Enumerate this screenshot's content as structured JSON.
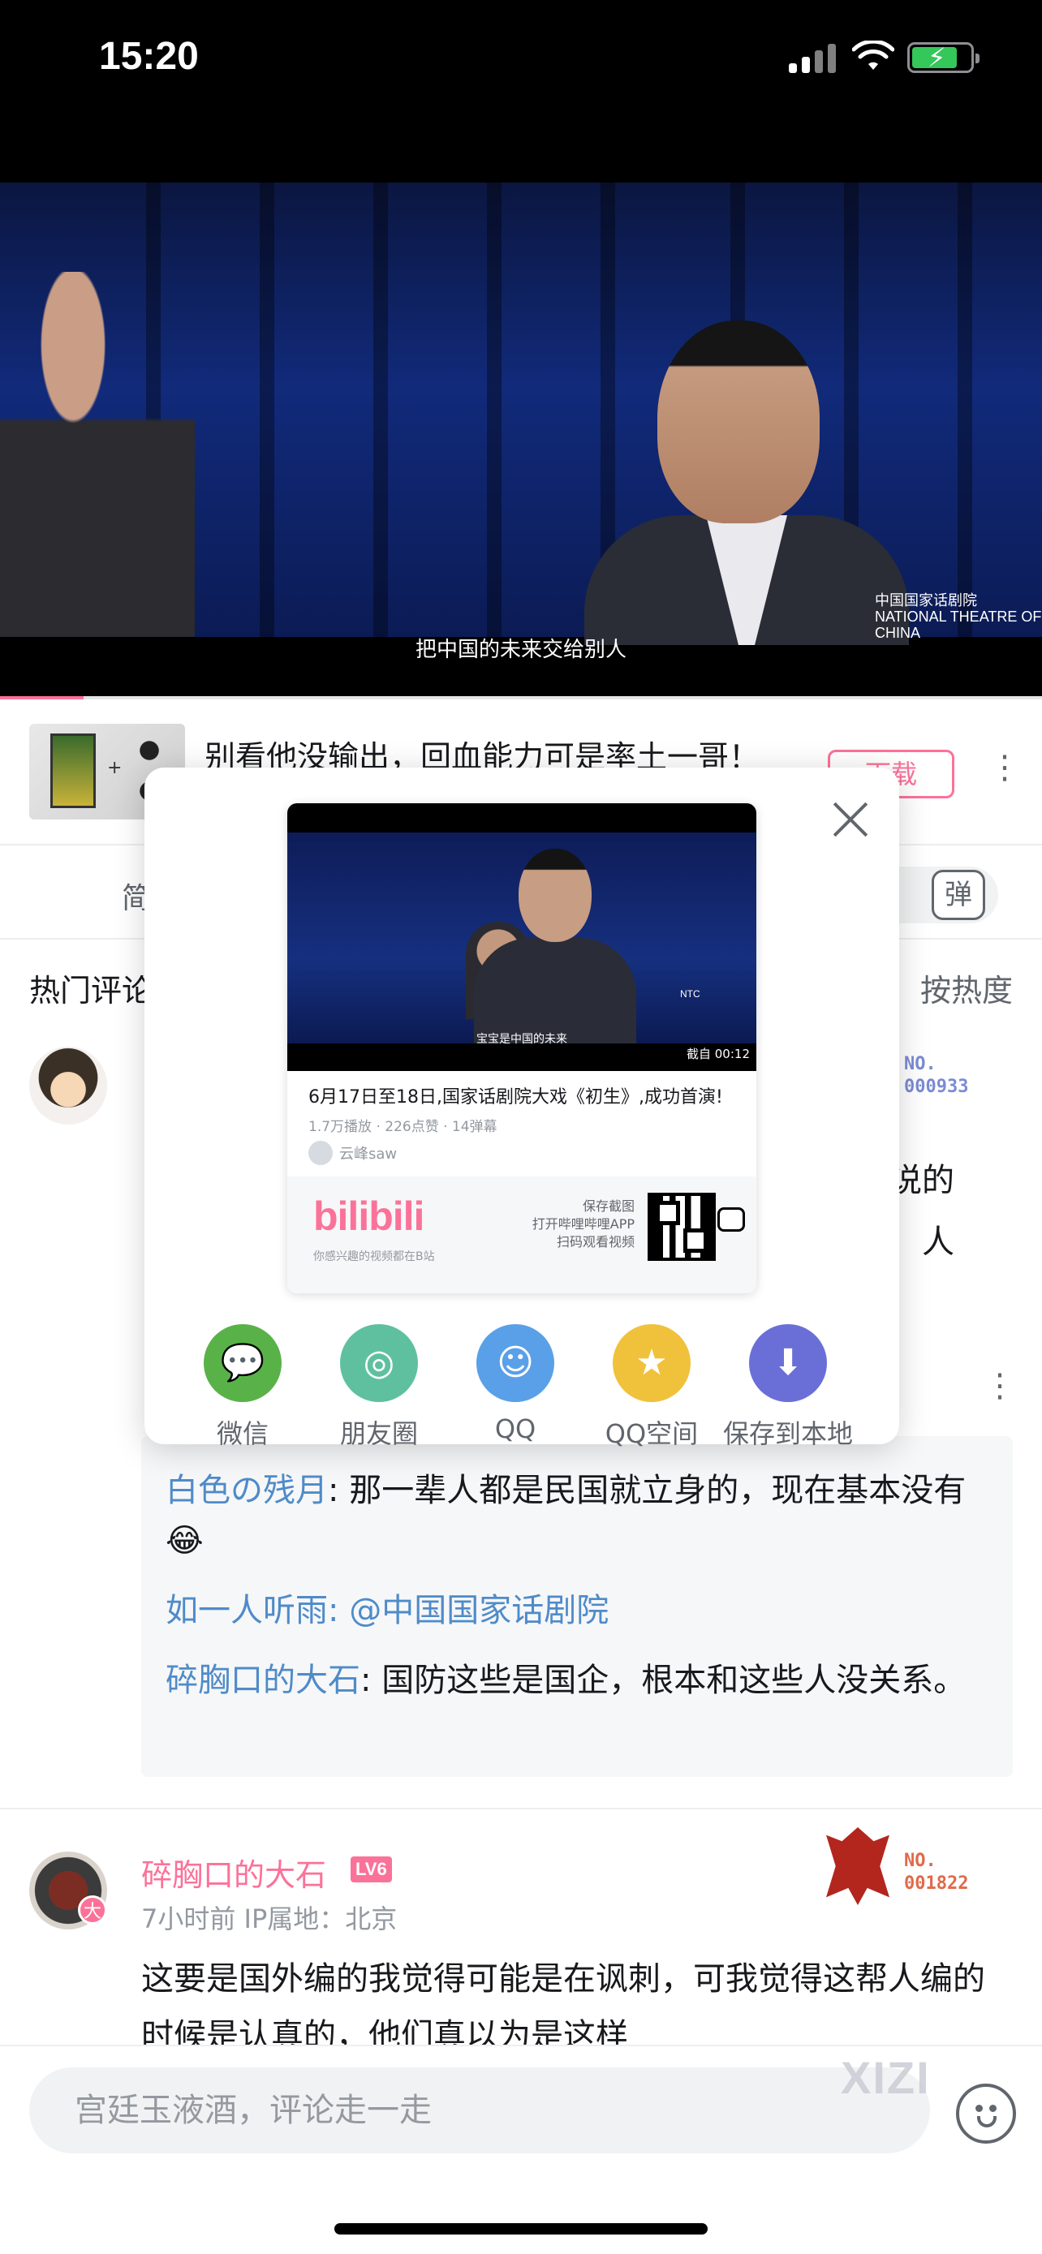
{
  "status_bar": {
    "time": "15:20"
  },
  "video": {
    "subtitle": "把中国的未来交给别人",
    "channel_logo": "中国国家话剧院\nNATIONAL THEATRE OF CHINA",
    "progress_fraction": 0.08
  },
  "related": {
    "title": "别看他没输出，回血能力可是率土一哥！",
    "download_label": "下载"
  },
  "tabs": {
    "intro": "简"
  },
  "comments": {
    "header": "热门评论",
    "sort": "按热度",
    "first": {
      "badge_no": "NO.",
      "badge_num": "000933",
      "partial_right_1": "说的",
      "partial_right_2": "人"
    },
    "replies": [
      {
        "name": "白色の残月",
        "text": ": 那一辈人都是民国就立身的，现在基本没有"
      },
      {
        "name": "如一人听雨",
        "text": ": @中国国家话剧院"
      },
      {
        "name": "碎胸口的大石",
        "text": ": 国防这些是国企，根本和这些人没关系。"
      }
    ],
    "second": {
      "user": "碎胸口的大石",
      "level": "LV6",
      "meta": "7小时前  IP属地：北京",
      "badge_no": "NO.",
      "badge_num": "001822",
      "vip": "大",
      "text": "这要是国外编的我觉得可能是在讽刺，可我觉得这帮人编的时候是认真的，他们真以为是这样"
    }
  },
  "bottom": {
    "input_placeholder": "宫廷玉液酒，评论走一走",
    "watermark": "XIZI"
  },
  "share": {
    "card": {
      "subtitle": "宝宝是中国的未来",
      "time": "截自 00:12",
      "title": "6月17日至18日,国家话剧院大戏《初生》,成功首演!",
      "stats": "1.7万播放 · 226点赞 · 14弹幕",
      "author": "云峰saw",
      "bili_logo": "bilibili",
      "tagline": "你感兴趣的视频都在B站",
      "qr_hint": [
        "保存截图",
        "打开哔哩哔哩APP",
        "扫码观看视频"
      ]
    },
    "targets": [
      {
        "label": "微信",
        "icon": "wechat-icon",
        "color": "#59b248"
      },
      {
        "label": "朋友圈",
        "icon": "moments-icon",
        "color": "#5fc0a0"
      },
      {
        "label": "QQ",
        "icon": "qq-icon",
        "color": "#5aa0e8"
      },
      {
        "label": "QQ空间",
        "icon": "qzone-icon",
        "color": "#f0c23b"
      },
      {
        "label": "保存到本地",
        "icon": "download-icon",
        "color": "#6a6fd8"
      }
    ]
  }
}
